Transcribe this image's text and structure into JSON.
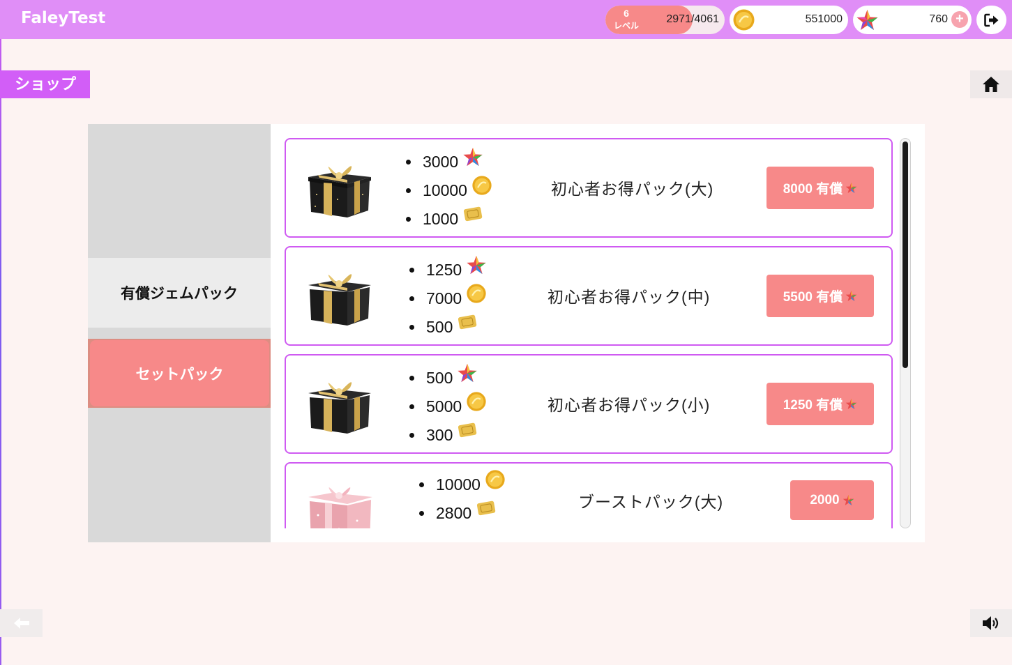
{
  "header": {
    "app_title": "FaleyTest",
    "level": {
      "number": "6",
      "label": "レベル",
      "exp": "2971/4061",
      "progress": 0.7316
    },
    "coins": "551000",
    "gems": "760",
    "add_label": "+"
  },
  "shop_label": "ショップ",
  "sidebar": {
    "items": [
      {
        "label": "有償ジェムパック",
        "selected": false
      },
      {
        "label": "セットパック",
        "selected": true
      }
    ]
  },
  "packs": [
    {
      "name": "初心者お得パック(大)",
      "price": "8000 有償",
      "gift_style": "black-gold",
      "items": [
        {
          "amount": "3000",
          "icon": "gem-star-icon"
        },
        {
          "amount": "10000",
          "icon": "coin-icon"
        },
        {
          "amount": "1000",
          "icon": "ticket-icon"
        }
      ]
    },
    {
      "name": "初心者お得パック(中)",
      "price": "5500 有償",
      "gift_style": "black-gold",
      "items": [
        {
          "amount": "1250",
          "icon": "gem-star-icon"
        },
        {
          "amount": "7000",
          "icon": "coin-icon"
        },
        {
          "amount": "500",
          "icon": "ticket-icon"
        }
      ]
    },
    {
      "name": "初心者お得パック(小)",
      "price": "1250 有償",
      "gift_style": "black-gold",
      "items": [
        {
          "amount": "500",
          "icon": "gem-star-icon"
        },
        {
          "amount": "5000",
          "icon": "coin-icon"
        },
        {
          "amount": "300",
          "icon": "ticket-icon"
        }
      ]
    },
    {
      "name": "ブーストパック(大)",
      "price": "2000",
      "gift_style": "pink",
      "items": [
        {
          "amount": "10000",
          "icon": "coin-icon"
        },
        {
          "amount": "2800",
          "icon": "ticket-icon"
        }
      ]
    }
  ],
  "colors": {
    "header_bg": "#e08ef7",
    "accent_purple": "#d25ef7",
    "button_pink": "#f78989",
    "page_bg": "#fdf3f2"
  }
}
